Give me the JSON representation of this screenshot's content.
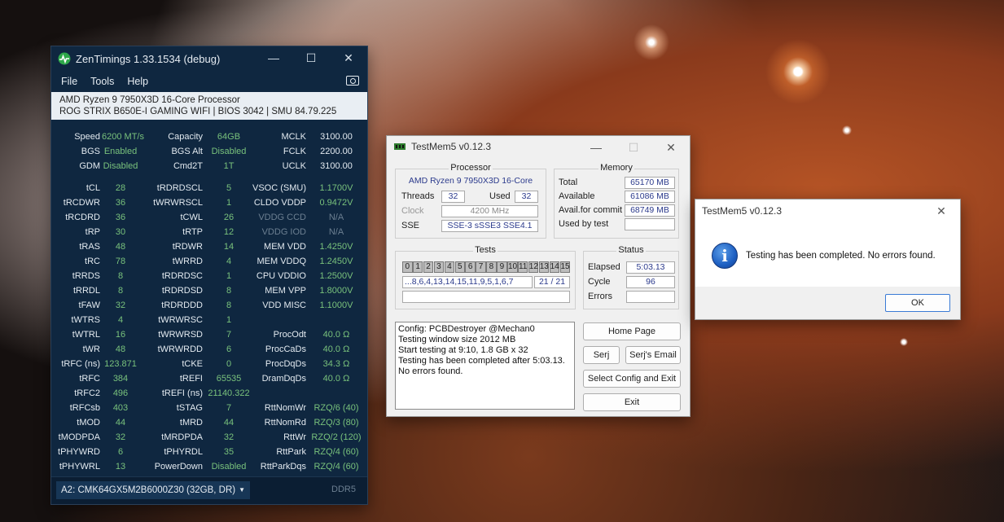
{
  "zentimings": {
    "title": "ZenTimings 1.33.1534 (debug)",
    "menu": [
      "File",
      "Tools",
      "Help"
    ],
    "cpu": "AMD Ryzen 9 7950X3D 16-Core Processor",
    "board": "ROG STRIX B650E-I GAMING WIFI | BIOS 3042 | SMU 84.79.225",
    "rows": [
      [
        "Speed",
        "6200 MT/s",
        "Capacity",
        "64GB",
        "MCLK",
        "3100.00"
      ],
      [
        "BGS",
        "Enabled",
        "BGS Alt",
        "Disabled",
        "FCLK",
        "2200.00"
      ],
      [
        "GDM",
        "Disabled",
        "Cmd2T",
        "1T",
        "UCLK",
        "3100.00"
      ],
      [
        "tCL",
        "28",
        "tRDRDSCL",
        "5",
        "VSOC (SMU)",
        "1.1700V"
      ],
      [
        "tRCDWR",
        "36",
        "tWRWRSCL",
        "1",
        "CLDO VDDP",
        "0.9472V"
      ],
      [
        "tRCDRD",
        "36",
        "tCWL",
        "26",
        "VDDG CCD",
        "N/A"
      ],
      [
        "tRP",
        "30",
        "tRTP",
        "12",
        "VDDG IOD",
        "N/A"
      ],
      [
        "tRAS",
        "48",
        "tRDWR",
        "14",
        "MEM VDD",
        "1.4250V"
      ],
      [
        "tRC",
        "78",
        "tWRRD",
        "4",
        "MEM VDDQ",
        "1.2450V"
      ],
      [
        "tRRDS",
        "8",
        "tRDRDSC",
        "1",
        "CPU VDDIO",
        "1.2500V"
      ],
      [
        "tRRDL",
        "8",
        "tRDRDSD",
        "8",
        "MEM VPP",
        "1.8000V"
      ],
      [
        "tFAW",
        "32",
        "tRDRDDD",
        "8",
        "VDD MISC",
        "1.1000V"
      ],
      [
        "tWTRS",
        "4",
        "tWRWRSC",
        "1",
        "",
        ""
      ],
      [
        "tWTRL",
        "16",
        "tWRWRSD",
        "7",
        "ProcOdt",
        "40.0 Ω"
      ],
      [
        "tWR",
        "48",
        "tWRWRDD",
        "6",
        "ProcCaDs",
        "40.0 Ω"
      ],
      [
        "tRFC (ns)",
        "123.871",
        "tCKE",
        "0",
        "ProcDqDs",
        "34.3 Ω"
      ],
      [
        "tRFC",
        "384",
        "tREFI",
        "65535",
        "DramDqDs",
        "40.0 Ω"
      ],
      [
        "tRFC2",
        "496",
        "tREFI (ns)",
        "21140.322",
        "",
        ""
      ],
      [
        "tRFCsb",
        "403",
        "tSTAG",
        "7",
        "RttNomWr",
        "RZQ/6 (40)"
      ],
      [
        "tMOD",
        "44",
        "tMRD",
        "44",
        "RttNomRd",
        "RZQ/3 (80)"
      ],
      [
        "tMODPDA",
        "32",
        "tMRDPDA",
        "32",
        "RttWr",
        "RZQ/2 (120)"
      ],
      [
        "tPHYWRD",
        "6",
        "tPHYRDL",
        "35",
        "RttPark",
        "RZQ/4 (60)"
      ],
      [
        "tPHYWRL",
        "13",
        "PowerDown",
        "Disabled",
        "RttParkDqs",
        "RZQ/4 (60)"
      ]
    ],
    "module": "A2: CMK64GX5M2B6000Z30 (32GB, DR)",
    "ddr": "DDR5"
  },
  "testmem": {
    "title": "TestMem5 v0.12.3",
    "processor": {
      "heading": "Processor",
      "name": "AMD Ryzen 9 7950X3D 16-Core",
      "threads_label": "Threads",
      "threads": "32",
      "used_label": "Used",
      "used": "32",
      "clock_label": "Clock",
      "clock": "4200 MHz",
      "sse_label": "SSE",
      "sse": "SSE-3 sSSE3 SSE4.1"
    },
    "memory": {
      "heading": "Memory",
      "total_label": "Total",
      "total": "65170 MB",
      "avail_label": "Available",
      "avail": "61086 MB",
      "commit_label": "Avail.for commit",
      "commit": "68749 MB",
      "used_label": "Used by test",
      "used": ""
    },
    "tests": {
      "heading": "Tests",
      "cells": [
        "0",
        "1",
        "2",
        "3",
        "4",
        "5",
        "6",
        "7",
        "8",
        "9",
        "10",
        "11",
        "12",
        "13",
        "14",
        "15"
      ],
      "sequence": "...8,6,4,13,14,15,11,9,5,1,6,7",
      "count": "21 / 21"
    },
    "status": {
      "heading": "Status",
      "elapsed_label": "Elapsed",
      "elapsed": "5:03.13",
      "cycle_label": "Cycle",
      "cycle": "96",
      "errors_label": "Errors",
      "errors": ""
    },
    "log": [
      "Config: PCBDestroyer @Mechan0",
      "Testing window size 2012 MB",
      "Start testing at 9:10, 1.8 GB x 32",
      "Testing has been completed after 5:03.13.",
      "No errors found."
    ],
    "buttons": {
      "home": "Home Page",
      "serj": "Serj",
      "email": "Serj's Email",
      "config": "Select Config and Exit",
      "exit": "Exit"
    }
  },
  "dialog": {
    "title": "TestMem5 v0.12.3",
    "message": "Testing has been completed. No errors found.",
    "ok": "OK"
  }
}
